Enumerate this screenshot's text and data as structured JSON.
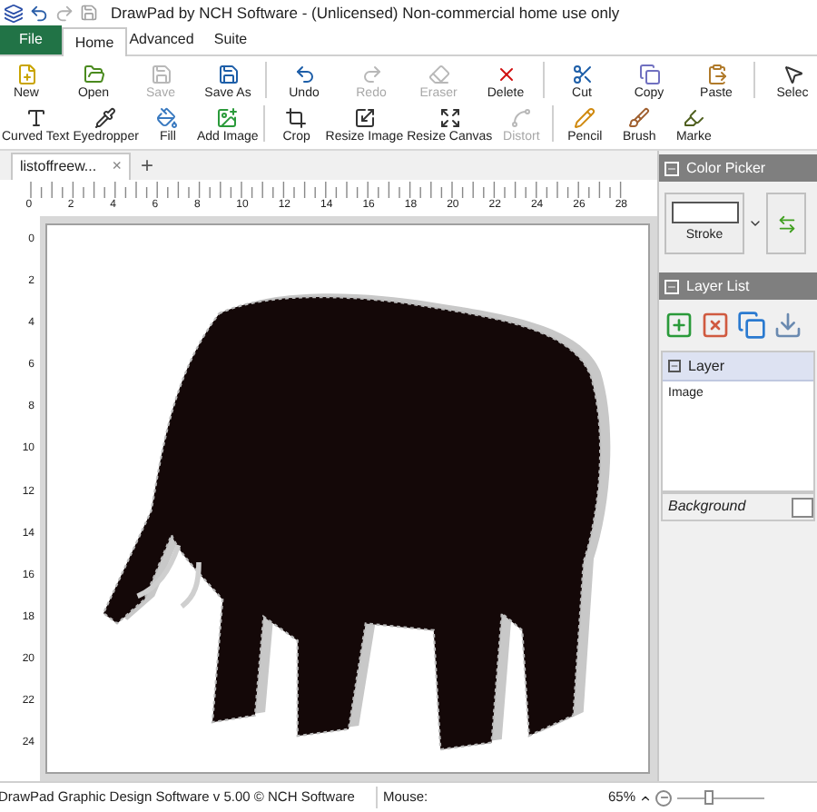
{
  "window": {
    "title": "DrawPad by NCH Software - (Unlicensed) Non-commercial home use only"
  },
  "ribbon_tabs": [
    {
      "label": "File",
      "kind": "file",
      "selected": false
    },
    {
      "label": "Home",
      "kind": "tab",
      "selected": true
    },
    {
      "label": "Advanced",
      "kind": "tab",
      "selected": false
    },
    {
      "label": "Suite",
      "kind": "tab",
      "selected": false
    }
  ],
  "toolbar_rows": [
    [
      {
        "label": "New",
        "disabled": false
      },
      {
        "label": "Open",
        "disabled": false
      },
      {
        "label": "Save",
        "disabled": true
      },
      {
        "label": "Save As",
        "disabled": false
      },
      {
        "kind": "separator"
      },
      {
        "label": "Undo",
        "disabled": false
      },
      {
        "label": "Redo",
        "disabled": true
      },
      {
        "label": "Eraser",
        "disabled": true
      },
      {
        "label": "Delete",
        "disabled": false
      },
      {
        "kind": "separator"
      },
      {
        "label": "Cut",
        "disabled": false
      },
      {
        "label": "Copy",
        "disabled": false
      },
      {
        "label": "Paste",
        "disabled": false
      },
      {
        "kind": "separator"
      },
      {
        "label": "Selec",
        "disabled": false
      }
    ],
    [
      {
        "label": "Curved Text",
        "disabled": false
      },
      {
        "label": "Eyedropper",
        "disabled": false
      },
      {
        "label": "Fill",
        "disabled": false
      },
      {
        "label": "Add Image",
        "disabled": false
      },
      {
        "kind": "separator"
      },
      {
        "label": "Crop",
        "disabled": false
      },
      {
        "label": "Resize Image",
        "disabled": false
      },
      {
        "label": "Resize Canvas",
        "disabled": false
      },
      {
        "label": "Distort",
        "disabled": true
      },
      {
        "kind": "separator"
      },
      {
        "label": "Pencil",
        "disabled": false
      },
      {
        "label": "Brush",
        "disabled": false
      },
      {
        "label": "Marke",
        "disabled": false
      }
    ]
  ],
  "document_tabs": [
    {
      "label": "listoffreew...",
      "close": "×",
      "selected": true
    }
  ],
  "new_tab": "+",
  "top_ruler": {
    "labels": [
      "0",
      "2",
      "4",
      "6",
      "8",
      "10",
      "12",
      "14",
      "16",
      "18",
      "20",
      "22",
      "24",
      "26",
      "28"
    ]
  },
  "left_ruler": {
    "labels": [
      "0",
      "2",
      "4",
      "6",
      "8",
      "10",
      "12",
      "14",
      "16",
      "18",
      "20",
      "22",
      "24"
    ]
  },
  "color_picker": {
    "title": "Color Picker",
    "stroke_label": "Stroke"
  },
  "layer_list": {
    "title": "Layer List",
    "header": "Layer",
    "layers": [
      {
        "name": "Image",
        "selected": false
      }
    ],
    "background_label": "Background"
  },
  "status_bar": {
    "text": "DrawPad Graphic Design Software v 5.00 © NCH Software",
    "mouse_label": "Mouse:",
    "zoom": "65%",
    "zoom_slider": {
      "level": 0.35
    }
  }
}
